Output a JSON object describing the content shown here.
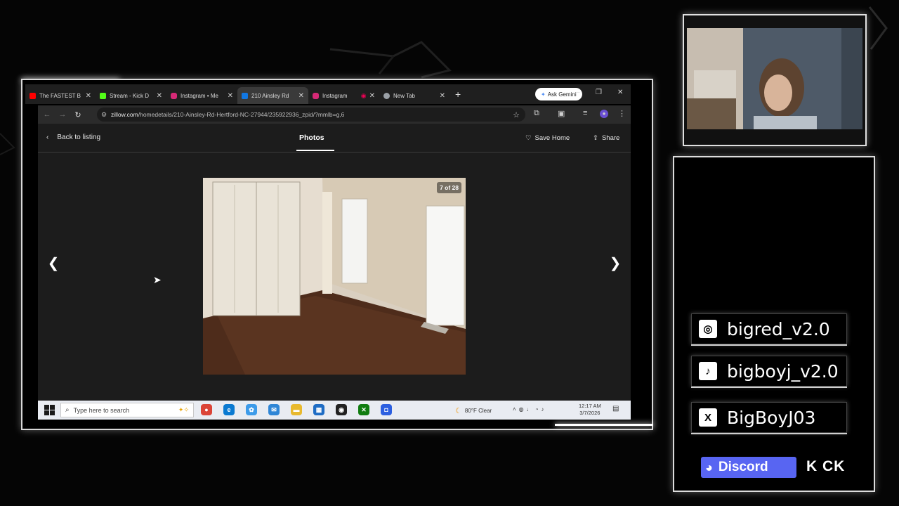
{
  "browser": {
    "tabs": [
      {
        "label": "The FASTEST B",
        "favicon_color": "#ff0000",
        "active": false
      },
      {
        "label": "Stream - Kick D",
        "favicon_color": "#53fc18",
        "active": false
      },
      {
        "label": "Instagram • Me",
        "favicon_color": "#d62976",
        "active": false
      },
      {
        "label": "210 Ainsley Rd",
        "favicon_color": "#1277e1",
        "active": true
      },
      {
        "label": "Instagram",
        "favicon_color": "#d62976",
        "active": false
      },
      {
        "label": "New Tab",
        "favicon_color": "#9aa0a6",
        "active": false
      }
    ],
    "ask_gemini": "Ask Gemini",
    "url_host": "zillow.com",
    "url_path": "/homedetails/210-Ainsley-Rd-Hertford-NC-27944/235922936_zpid/?mmlb=g,6"
  },
  "page": {
    "back_label": "Back to listing",
    "photos_tab": "Photos",
    "save_home": "Save Home",
    "share": "Share",
    "photo_counter": "7 of 28"
  },
  "taskbar": {
    "search_placeholder": "Type here to search",
    "weather": "80°F  Clear",
    "time": "12:17 AM",
    "date": "3/7/2026"
  },
  "overlay": {
    "socials": [
      {
        "icon": "instagram-icon",
        "glyph": "◎",
        "handle": "bigred_v2.0"
      },
      {
        "icon": "tiktok-icon",
        "glyph": "♪",
        "handle": "bigboyj_v2.0"
      },
      {
        "icon": "x-icon",
        "glyph": "X",
        "handle": "BigBoyJ03"
      }
    ],
    "discord_label": "Discord",
    "kick_label": "K CK"
  }
}
